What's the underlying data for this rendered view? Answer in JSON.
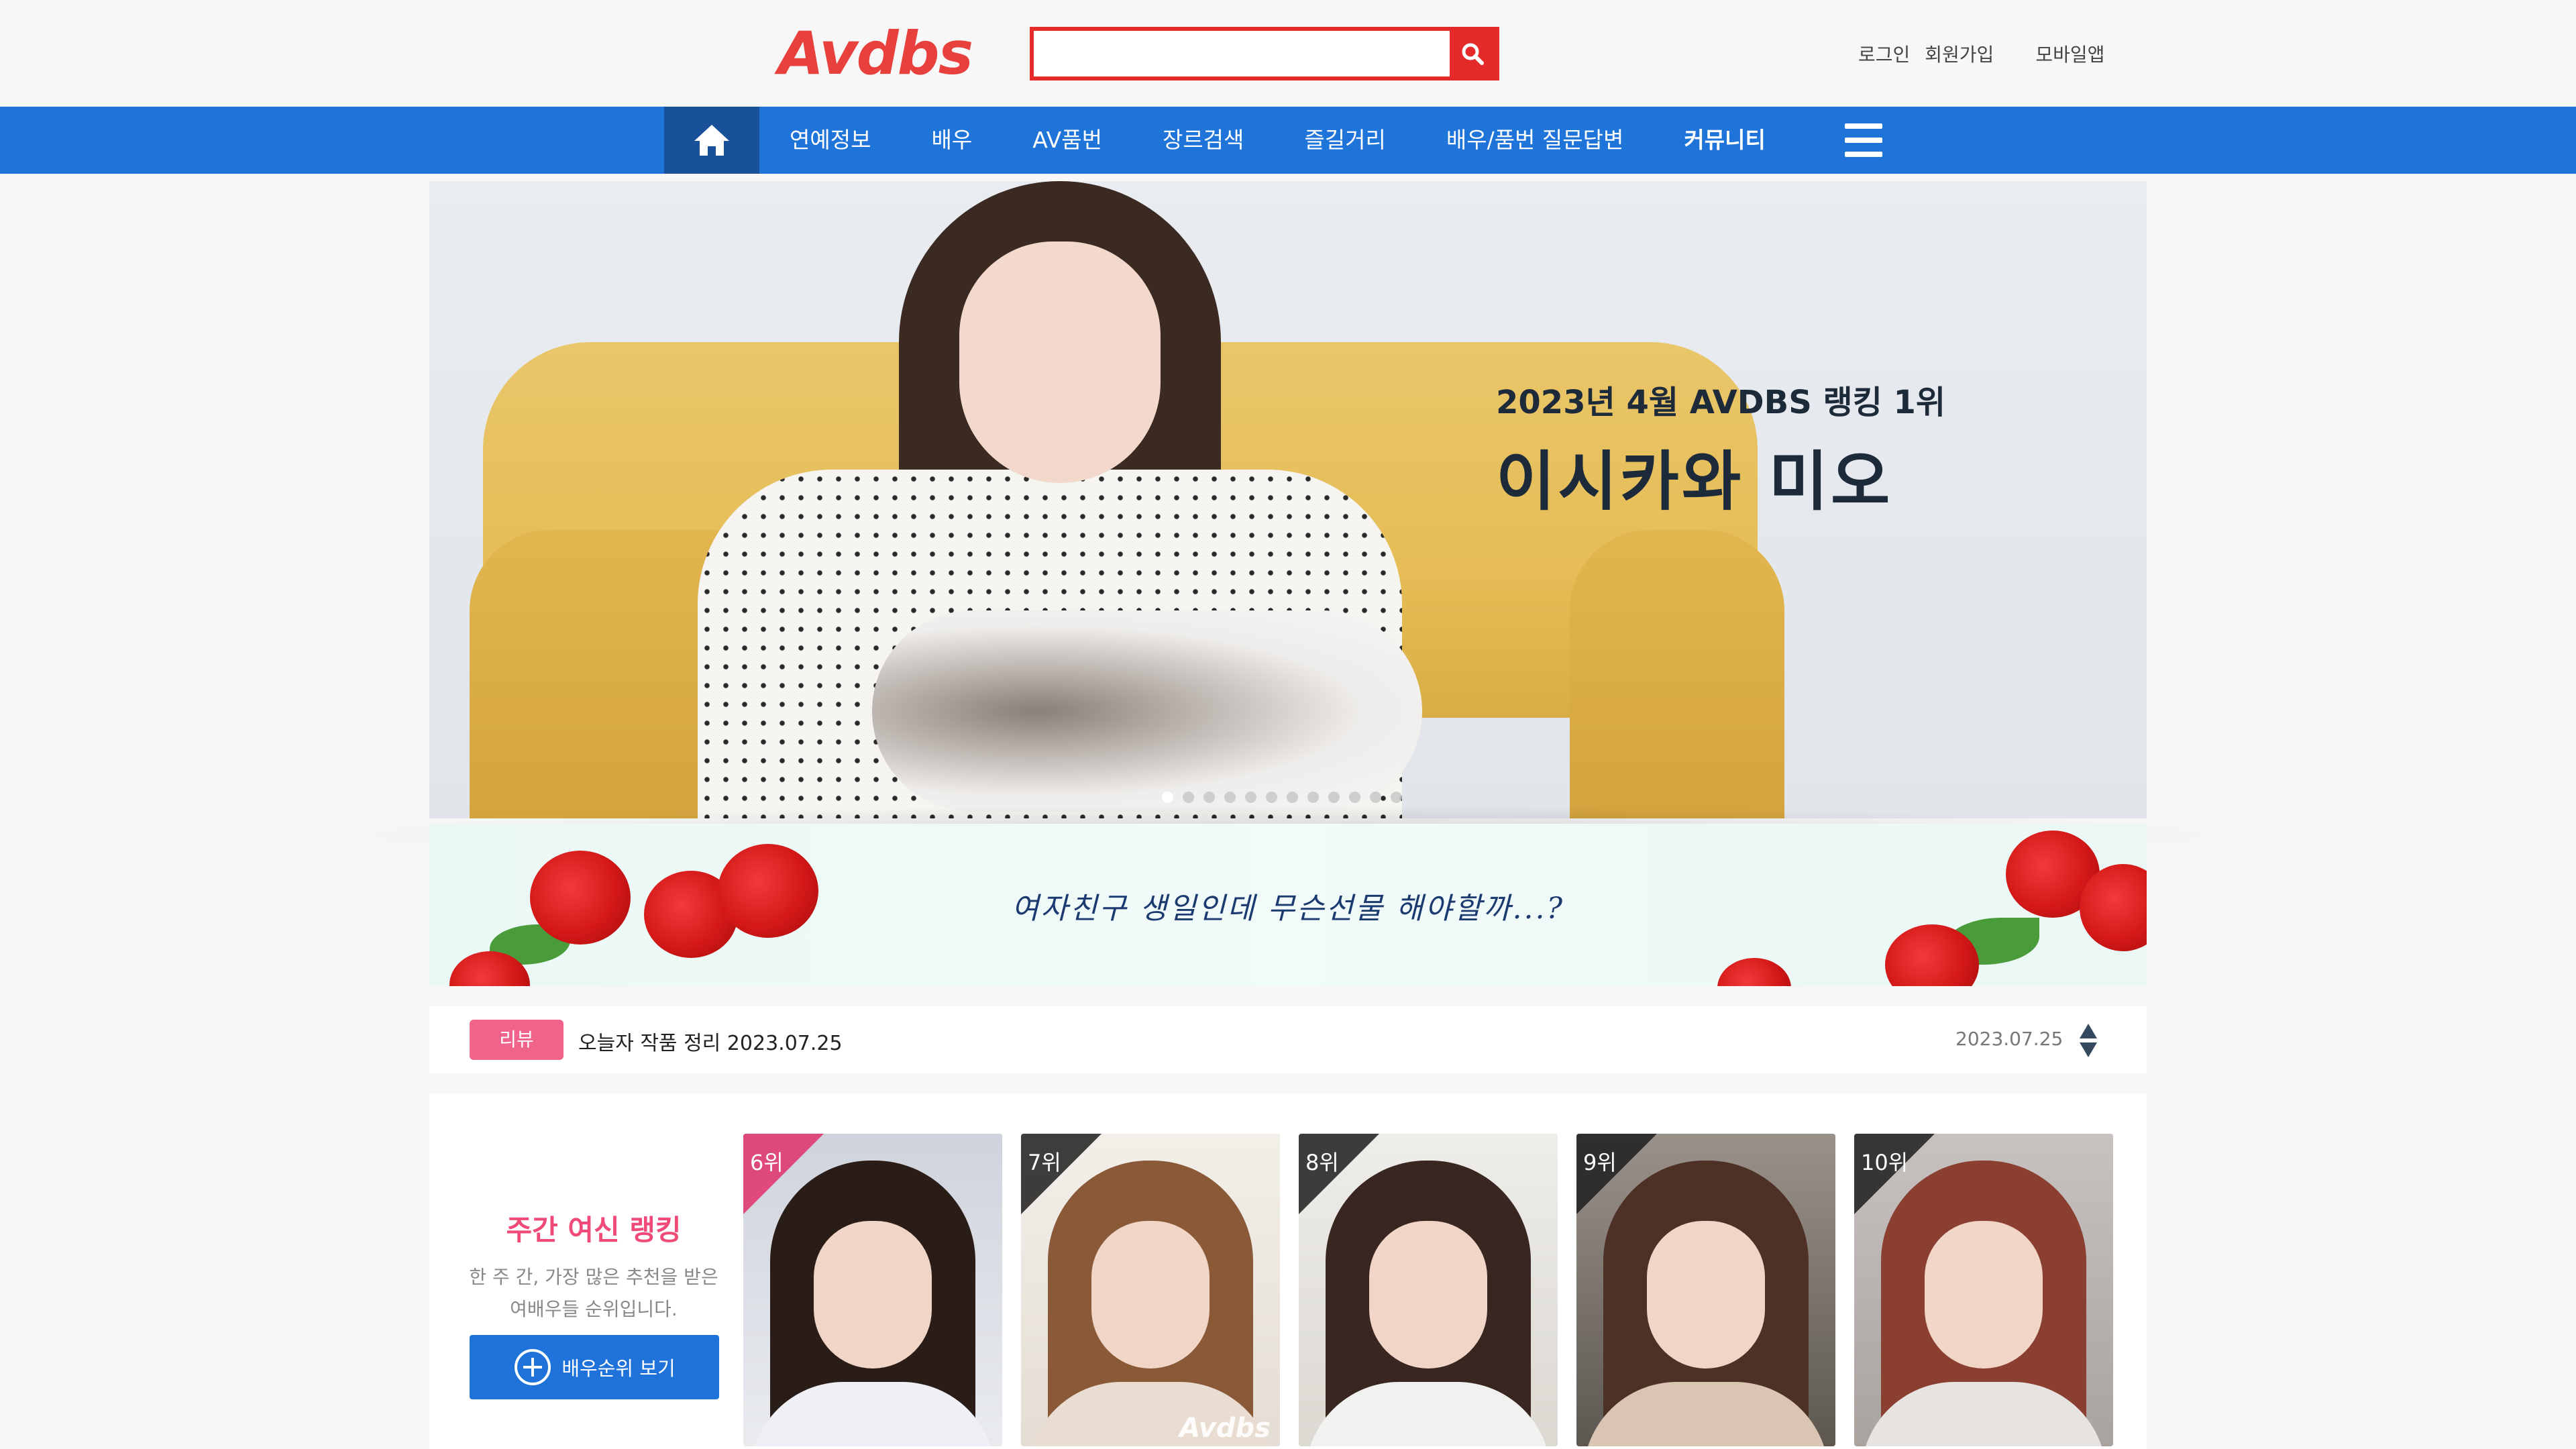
{
  "header": {
    "logo_text": "Avdbs",
    "search": {
      "value": "",
      "placeholder": ""
    },
    "links": {
      "login": "로그인",
      "signup": "회원가입",
      "mobile_app": "모바일앱"
    }
  },
  "nav": {
    "items": [
      {
        "label": "연예정보",
        "bold": false
      },
      {
        "label": "배우",
        "bold": false
      },
      {
        "label": "AV품번",
        "bold": false
      },
      {
        "label": "장르검색",
        "bold": false
      },
      {
        "label": "즐길거리",
        "bold": false
      },
      {
        "label": "배우/품번 질문답변",
        "bold": false
      },
      {
        "label": "커뮤니티",
        "bold": true
      }
    ]
  },
  "hero": {
    "subtitle": "2023년 4월 AVDBS 랭킹 1위",
    "title": "이시카와 미오",
    "slide_count": 12,
    "active_slide": 1
  },
  "banner": {
    "text": "여자친구 생일인데 무슨선물 해야할까...?"
  },
  "ticker": {
    "badge": "리뷰",
    "title": "오늘자 작품 정리 2023.07.25",
    "date": "2023.07.25"
  },
  "ranking": {
    "title": "주간 여신 랭킹",
    "description_line1": "한 주 간, 가장 많은 추천을 받은",
    "description_line2": "여배우들 순위입니다.",
    "button_label": "배우순위 보기",
    "cards": [
      {
        "rank": "6위",
        "watermark": ""
      },
      {
        "rank": "7위",
        "watermark": "Avdbs"
      },
      {
        "rank": "8위",
        "watermark": ""
      },
      {
        "rank": "9위",
        "watermark": ""
      },
      {
        "rank": "10위",
        "watermark": ""
      }
    ]
  },
  "colors": {
    "brand_red": "#e8403d",
    "nav_blue": "#1e74d8",
    "nav_home_blue": "#19509a",
    "badge_pink": "#f0638a",
    "ranking_pink": "#ef4a78",
    "button_blue": "#1f72d9"
  },
  "icons": {
    "search": "search-icon",
    "home": "home-icon",
    "menu": "hamburger-menu-icon",
    "ticker_nav": "up-down-arrows-icon",
    "add": "plus-circle-icon"
  }
}
